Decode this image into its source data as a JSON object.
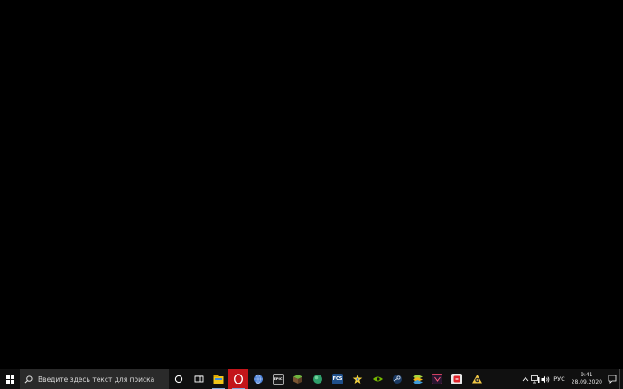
{
  "taskbar": {
    "search": {
      "placeholder": "Введите здесь текст для поиска",
      "icon": "search-icon"
    },
    "pinned_apps": [
      {
        "name": "cortana-icon"
      },
      {
        "name": "task-view-icon"
      },
      {
        "name": "file-explorer-icon"
      },
      {
        "name": "opera-browser-icon",
        "active": true
      },
      {
        "name": "browser-globe-icon"
      },
      {
        "name": "epic-games-icon",
        "label": "EPIC"
      },
      {
        "name": "minecraft-icon"
      },
      {
        "name": "green-globe-icon"
      },
      {
        "name": "fcs-app-icon",
        "label": "FCS"
      },
      {
        "name": "star-app-icon"
      },
      {
        "name": "nvidia-icon"
      },
      {
        "name": "steam-icon"
      },
      {
        "name": "bluestacks-icon"
      },
      {
        "name": "purple-app-icon"
      },
      {
        "name": "red-app-icon"
      },
      {
        "name": "gear-app-icon"
      }
    ],
    "tray": {
      "language": "РУС",
      "time": "9:41",
      "date": "28.09.2020"
    }
  }
}
